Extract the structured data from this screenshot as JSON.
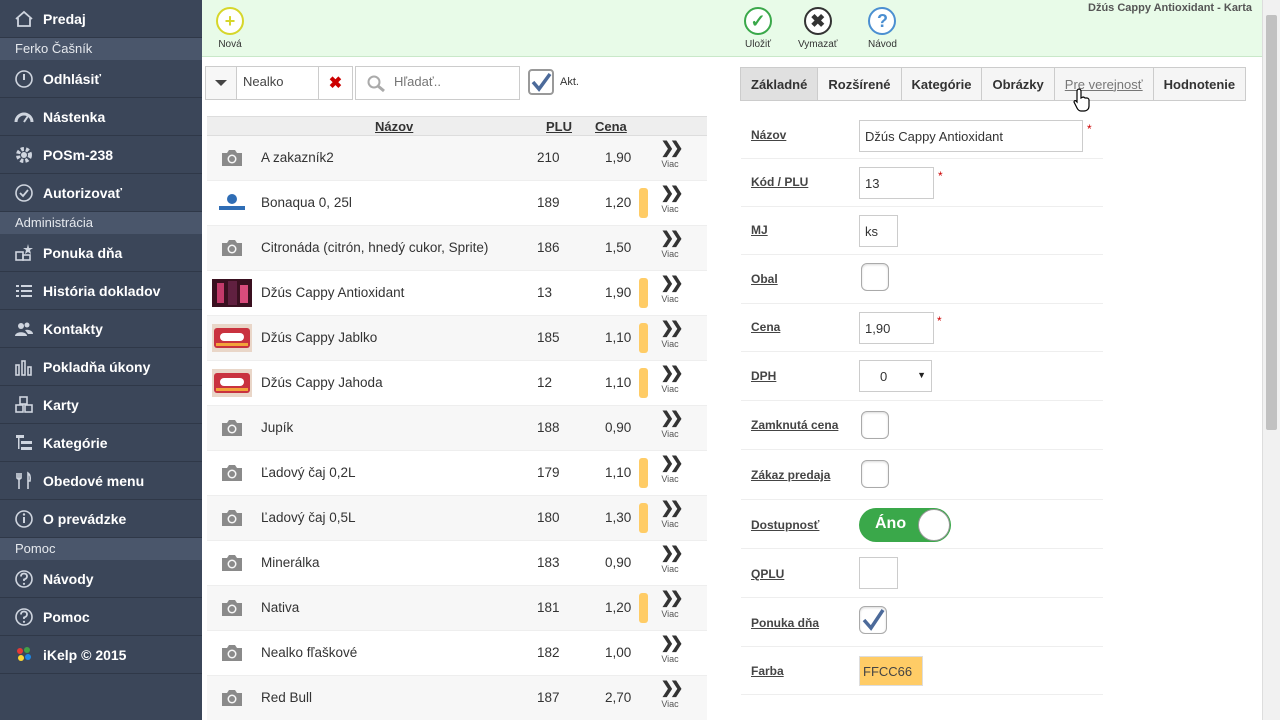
{
  "window_title": "Džús Cappy Antioxidant - Karta",
  "sidebar": {
    "items": [
      {
        "label": "Predaj",
        "icon": "home-icon",
        "type": "item"
      },
      {
        "label": "Ferko Čašník",
        "type": "section"
      },
      {
        "label": "Odhlásiť",
        "icon": "power-icon",
        "type": "item"
      },
      {
        "label": "Nástenka",
        "icon": "dashboard-icon",
        "type": "item"
      },
      {
        "label": "POSm-238",
        "icon": "gear-icon",
        "type": "item"
      },
      {
        "label": "Autorizovať",
        "icon": "check-circle-icon",
        "type": "item"
      },
      {
        "label": "Administrácia",
        "type": "section"
      },
      {
        "label": "Ponuka dňa",
        "icon": "offer-icon",
        "type": "item"
      },
      {
        "label": "História dokladov",
        "icon": "list-icon",
        "type": "item"
      },
      {
        "label": "Kontakty",
        "icon": "users-icon",
        "type": "item"
      },
      {
        "label": "Pokladňa úkony",
        "icon": "bar-chart-icon",
        "type": "item"
      },
      {
        "label": "Karty",
        "icon": "cubes-icon",
        "type": "item"
      },
      {
        "label": "Kategórie",
        "icon": "tree-icon",
        "type": "item"
      },
      {
        "label": "Obedové menu",
        "icon": "cutlery-icon",
        "type": "item"
      },
      {
        "label": "O prevádzke",
        "icon": "info-icon",
        "type": "item"
      },
      {
        "label": "Pomoc",
        "type": "section"
      },
      {
        "label": "Návody",
        "icon": "question-icon",
        "type": "item"
      },
      {
        "label": "Pomoc",
        "icon": "help-icon",
        "type": "item"
      },
      {
        "label": "iKelp © 2015",
        "icon": "ikelp-logo-icon",
        "type": "item"
      }
    ],
    "logo_text": "iKelp"
  },
  "toolbar": {
    "new_label": "Nová",
    "save_label": "Uložiť",
    "delete_label": "Vymazať",
    "help_label": "Návod"
  },
  "filter": {
    "category_value": "Nealko",
    "search_placeholder": "Hľadať..",
    "active_label": "Akt."
  },
  "list": {
    "headers": {
      "name": "Názov",
      "plu": "PLU",
      "price": "Cena"
    },
    "more_label": "Viac",
    "rows": [
      {
        "name": "A zakazník2",
        "plu": "210",
        "price": "1,90",
        "thumb": "camera",
        "color": ""
      },
      {
        "name": "Bonaqua 0, 25l",
        "plu": "189",
        "price": "1,20",
        "thumb": "bonaqua",
        "color": "#FFCC66"
      },
      {
        "name": "Citronáda (citrón, hnedý cukor, Sprite)",
        "plu": "186",
        "price": "1,50",
        "thumb": "camera",
        "color": ""
      },
      {
        "name": "Džús Cappy Antioxidant",
        "plu": "13",
        "price": "1,90",
        "thumb": "cappy-dark",
        "color": "#FFCC66"
      },
      {
        "name": "Džús Cappy Jablko",
        "plu": "185",
        "price": "1,10",
        "thumb": "cappy",
        "color": "#FFCC66"
      },
      {
        "name": "Džús Cappy Jahoda",
        "plu": "12",
        "price": "1,10",
        "thumb": "cappy",
        "color": "#FFCC66"
      },
      {
        "name": "Jupík",
        "plu": "188",
        "price": "0,90",
        "thumb": "camera",
        "color": ""
      },
      {
        "name": "Ľadový čaj 0,2L",
        "plu": "179",
        "price": "1,10",
        "thumb": "camera",
        "color": "#FFCC66"
      },
      {
        "name": "Ľadový čaj 0,5L",
        "plu": "180",
        "price": "1,30",
        "thumb": "camera",
        "color": "#FFCC66"
      },
      {
        "name": "Minerálka",
        "plu": "183",
        "price": "0,90",
        "thumb": "camera",
        "color": ""
      },
      {
        "name": "Nativa",
        "plu": "181",
        "price": "1,20",
        "thumb": "camera",
        "color": "#FFCC66"
      },
      {
        "name": "Nealko fľaškové",
        "plu": "182",
        "price": "1,00",
        "thumb": "camera",
        "color": ""
      },
      {
        "name": "Red Bull",
        "plu": "187",
        "price": "2,70",
        "thumb": "camera",
        "color": ""
      }
    ]
  },
  "tabs": [
    "Základné",
    "Rozšírené",
    "Kategórie",
    "Obrázky",
    "Pre verejnosť",
    "Hodnotenie"
  ],
  "form": {
    "name_label": "Názov",
    "name_value": "Džús Cappy Antioxidant",
    "plu_label": "Kód / PLU",
    "plu_value": "13",
    "unit_label": "MJ",
    "unit_value": "ks",
    "package_label": "Obal",
    "price_label": "Cena",
    "price_value": "1,90",
    "vat_label": "DPH",
    "vat_value": "0",
    "locked_price_label": "Zamknutá cena",
    "sale_ban_label": "Zákaz predaja",
    "availability_label": "Dostupnosť",
    "availability_value": "Áno",
    "qplu_label": "QPLU",
    "daily_offer_label": "Ponuka dňa",
    "color_label": "Farba",
    "color_value": "FFCC66",
    "required_mark": "*"
  },
  "colors": {
    "sidebar_bg": "#3b4659",
    "toolbar_bg": "#e8fbe8",
    "accent_green": "#3aa84a",
    "row_color": "#FFCC66",
    "required": "#cc0000"
  }
}
